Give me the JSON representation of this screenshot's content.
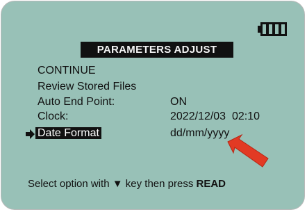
{
  "screen": {
    "title": "PARAMETERS ADJUST",
    "battery_icon": "battery-full-icon",
    "menu": [
      {
        "label": "CONTINUE",
        "value": ""
      },
      {
        "label": "Review Stored Files",
        "value": ""
      },
      {
        "label": "Auto End Point:",
        "value": "ON"
      },
      {
        "label": "Clock:",
        "value": "2022/12/03  02:10"
      },
      {
        "label": "Date Format",
        "value": "dd/mm/yyyy",
        "selected": true
      }
    ],
    "footer": {
      "prefix": "Select option with",
      "key_symbol": "▼",
      "middle": "key then press",
      "action": "READ"
    }
  },
  "colors": {
    "screen_bg": "#98c1b7",
    "text": "#111111",
    "highlight_bg": "#111111",
    "annotation_arrow": "#e23a24"
  }
}
